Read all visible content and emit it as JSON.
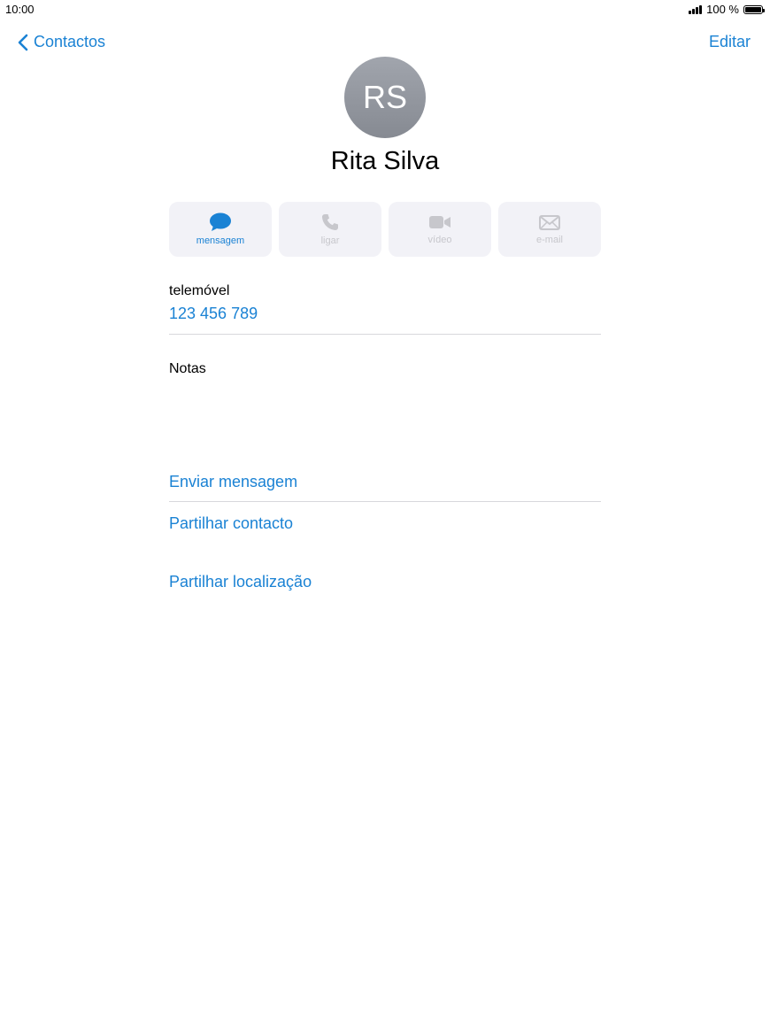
{
  "status_bar": {
    "time": "10:00",
    "battery_text": "100 %",
    "battery_level": 1.0
  },
  "nav": {
    "back_label": "Contactos",
    "edit_label": "Editar"
  },
  "contact": {
    "initials": "RS",
    "name": "Rita Silva"
  },
  "actions": [
    {
      "label": "mensagem",
      "icon": "message-bubble-icon",
      "enabled": true
    },
    {
      "label": "ligar",
      "icon": "phone-icon",
      "enabled": false
    },
    {
      "label": "vídeo",
      "icon": "video-camera-icon",
      "enabled": false
    },
    {
      "label": "e-mail",
      "icon": "envelope-icon",
      "enabled": false
    }
  ],
  "phone": {
    "label": "telemóvel",
    "value": "123 456 789"
  },
  "notes": {
    "label": "Notas"
  },
  "links": {
    "send_message": "Enviar mensagem",
    "share_contact": "Partilhar contacto",
    "share_location": "Partilhar localização"
  },
  "colors": {
    "accent": "#1a82d4",
    "button_bg": "#f2f2f7",
    "disabled": "#c7c7cc"
  }
}
